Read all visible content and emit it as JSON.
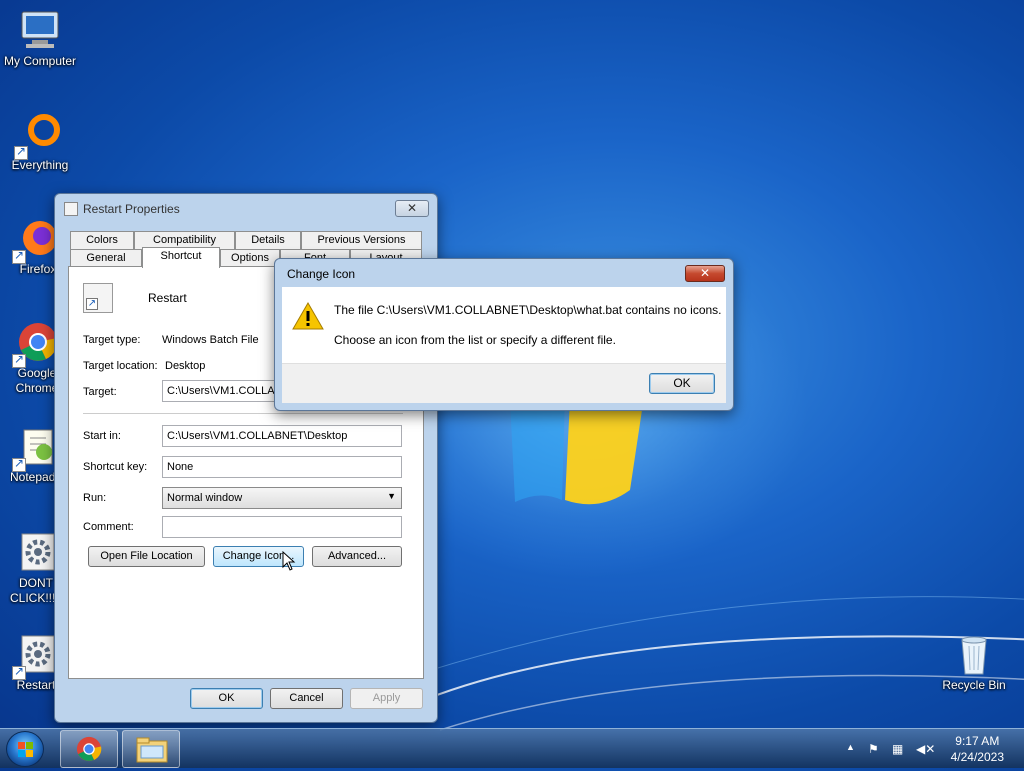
{
  "desktop": {
    "icons": [
      {
        "label": "My Computer"
      },
      {
        "label": "Everything"
      },
      {
        "label": "Firefox"
      },
      {
        "label": "Google Chrome"
      },
      {
        "label": "Notepad++"
      },
      {
        "label": "DONT CLICK!!!!!"
      },
      {
        "label": "Restart"
      },
      {
        "label": "Recycle Bin"
      }
    ]
  },
  "properties": {
    "title": "Restart Properties",
    "tabs_row1": [
      "Colors",
      "Compatibility",
      "Details",
      "Previous Versions"
    ],
    "tabs_row2": [
      "General",
      "Shortcut",
      "Options",
      "Font",
      "Layout"
    ],
    "active_tab": "Shortcut",
    "name": "Restart",
    "target_type_label": "Target type:",
    "target_type_value": "Windows Batch File",
    "target_location_label": "Target location:",
    "target_location_value": "Desktop",
    "target_label": "Target:",
    "target_value": "C:\\Users\\VM1.COLLABNET\\Desktop\\what.bat",
    "start_in_label": "Start in:",
    "start_in_value": "C:\\Users\\VM1.COLLABNET\\Desktop",
    "shortcut_key_label": "Shortcut key:",
    "shortcut_key_value": "None",
    "run_label": "Run:",
    "run_value": "Normal window",
    "comment_label": "Comment:",
    "comment_value": "",
    "open_file_location": "Open File Location",
    "change_icon": "Change Icon...",
    "advanced": "Advanced...",
    "ok": "OK",
    "cancel": "Cancel",
    "apply": "Apply"
  },
  "change_icon_dialog": {
    "title": "Change Icon",
    "message_line1": "The file C:\\Users\\VM1.COLLABNET\\Desktop\\what.bat contains no icons.",
    "message_line2": "Choose an icon from the list or specify a different file.",
    "ok": "OK",
    "icon": "warning-icon"
  },
  "taskbar": {
    "time": "9:17 AM",
    "date": "4/24/2023",
    "pinned": [
      "chrome-icon",
      "explorer-icon"
    ]
  }
}
